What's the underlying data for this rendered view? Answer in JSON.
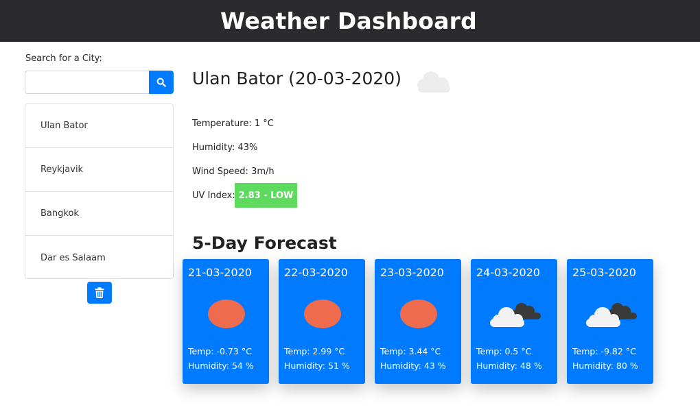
{
  "header": {
    "title": "Weather Dashboard"
  },
  "search": {
    "label": "Search for a City:",
    "value": "",
    "placeholder": ""
  },
  "cities": [
    "Ulan Bator",
    "Reykjavik",
    "Bangkok",
    "Dar es Salaam"
  ],
  "current": {
    "title": "Ulan Bator (20-03-2020)",
    "icon": "cloud-icon",
    "temperature": "Temperature: 1 °C",
    "humidity": "Humidity: 43%",
    "wind": "Wind Speed: 3m/h",
    "uv_label": "UV Index:",
    "uv_value": "2.83 - LOW",
    "uv_color": "#5edb5e"
  },
  "forecast": {
    "title": "5-Day Forecast",
    "days": [
      {
        "date": "21-03-2020",
        "icon": "sun-icon",
        "temp": "Temp: -0.73 °C",
        "humidity": "Humidity: 54 %"
      },
      {
        "date": "22-03-2020",
        "icon": "sun-icon",
        "temp": "Temp: 2.99 °C",
        "humidity": "Humidity: 51 %"
      },
      {
        "date": "23-03-2020",
        "icon": "sun-icon",
        "temp": "Temp: 3.44 °C",
        "humidity": "Humidity: 43 %"
      },
      {
        "date": "24-03-2020",
        "icon": "clouds-icon",
        "temp": "Temp: 0.5 °C",
        "humidity": "Humidity: 48 %"
      },
      {
        "date": "25-03-2020",
        "icon": "clouds-icon",
        "temp": "Temp: -9.82 °C",
        "humidity": "Humidity: 80 %"
      }
    ]
  },
  "colors": {
    "header_bg": "#2b2a2e",
    "accent": "#007bff",
    "sun": "#ee6b4d"
  }
}
